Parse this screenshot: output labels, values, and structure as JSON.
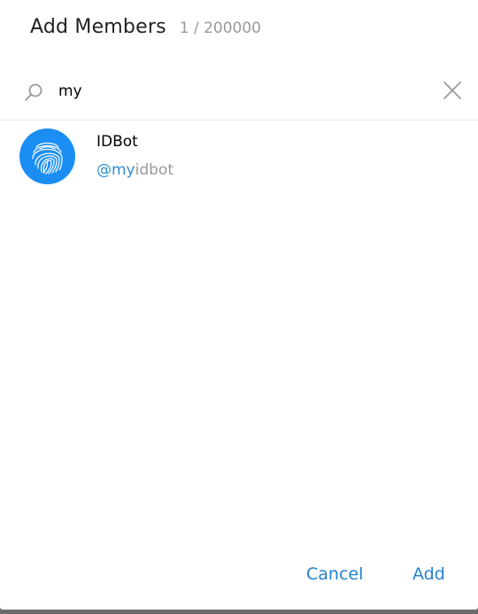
{
  "dialog": {
    "title": "Add Members",
    "member_count": "1 / 200000"
  },
  "search": {
    "value": "my",
    "placeholder": "",
    "icon": "search-icon",
    "clear_icon": "close-icon"
  },
  "results": [
    {
      "name": "IDBot",
      "username_match": "@my",
      "username_rest": "idbot",
      "avatar_icon": "fingerprint-icon",
      "avatar_color": "#1b8ef3"
    }
  ],
  "footer": {
    "cancel_label": "Cancel",
    "add_label": "Add"
  },
  "colors": {
    "accent": "#2481cc",
    "highlight": "#2f8fd0",
    "secondary_text": "#999999"
  }
}
